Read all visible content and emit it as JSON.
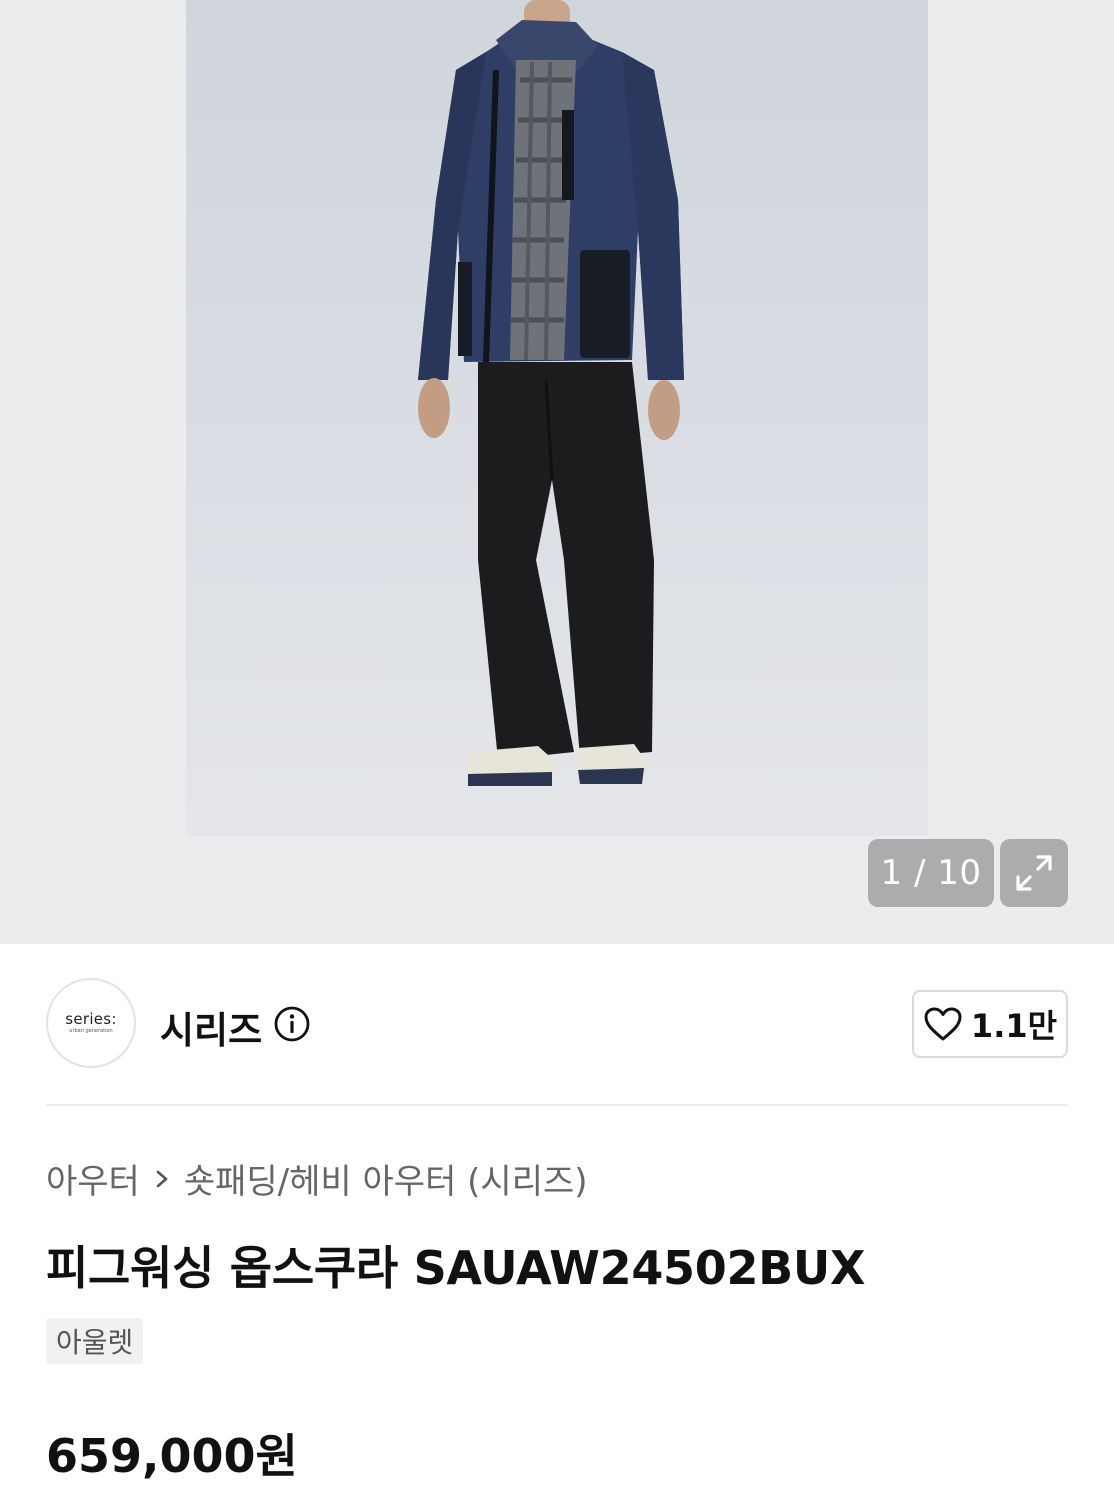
{
  "gallery": {
    "current_image": 1,
    "total_images": 10,
    "counter_text": "1 / 10",
    "expand_icon": "expand-arrows-icon"
  },
  "brand": {
    "logo_text": "series:",
    "logo_subtext": "urban generation",
    "name": "시리즈",
    "info_icon": "info-circle-icon",
    "like_icon": "heart-outline-icon",
    "like_count": "1.1만"
  },
  "breadcrumb": {
    "items": [
      "아우터",
      "숏패딩/헤비 아우터 (시리즈)"
    ],
    "separator_icon": "chevron-right-icon"
  },
  "product": {
    "title": "피그워싱 옵스쿠라 SAUAW24502BUX",
    "tag": "아울렛",
    "price": "659,000원"
  }
}
